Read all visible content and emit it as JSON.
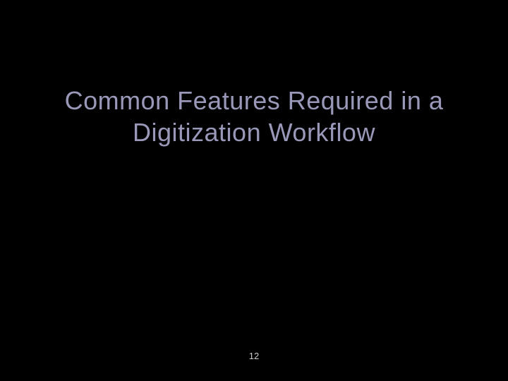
{
  "slide": {
    "title_line1": "Common Features Required in a",
    "title_line2": "Digitization Workflow",
    "page_number": "12"
  }
}
